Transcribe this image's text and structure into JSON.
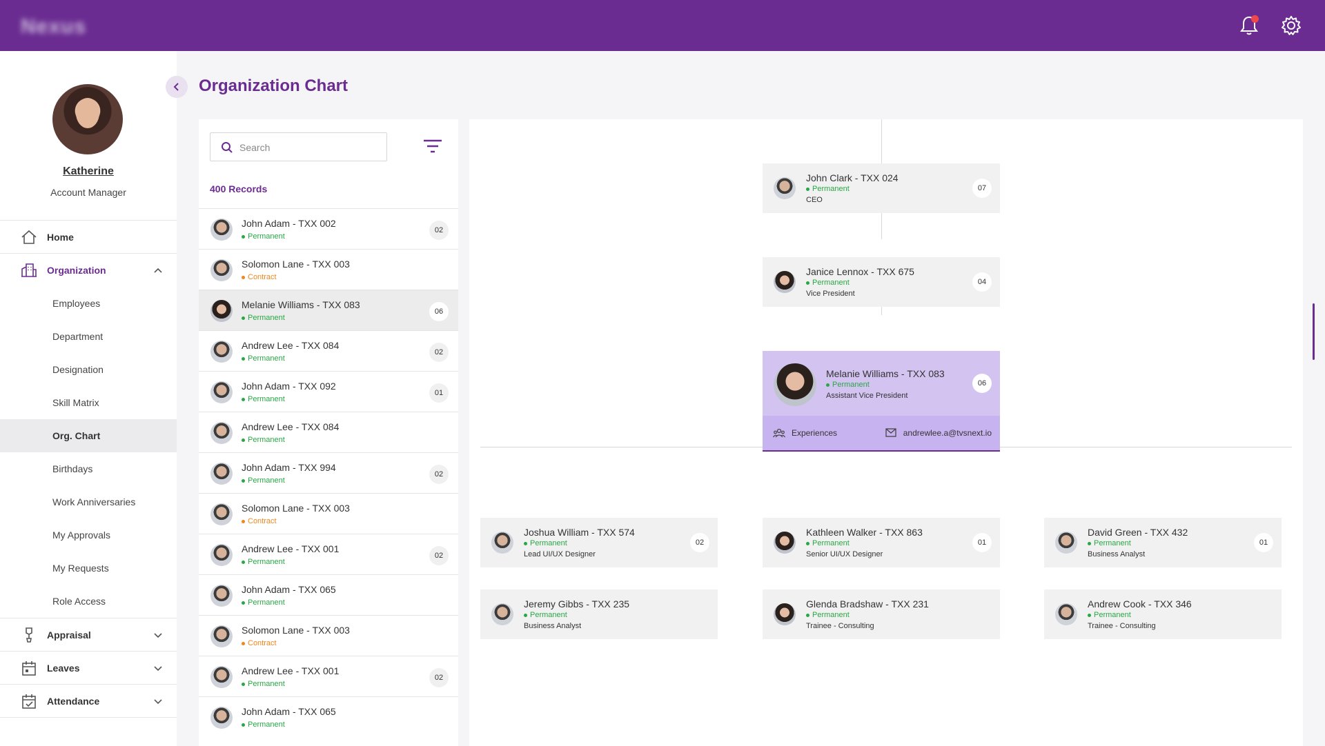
{
  "app": {
    "brand": "Nexus"
  },
  "user": {
    "name": "Katherine",
    "role": "Account Manager"
  },
  "nav": {
    "home": "Home",
    "organization": "Organization",
    "org_subitems": [
      "Employees",
      "Department",
      "Designation",
      "Skill Matrix",
      "Org. Chart",
      "Birthdays",
      "Work Anniversaries",
      "My Approvals",
      "My Requests",
      "Role Access"
    ],
    "selected_subitem": "Org. Chart",
    "appraisal": "Appraisal",
    "leaves": "Leaves",
    "attendance": "Attendance"
  },
  "page": {
    "title": "Organization Chart"
  },
  "list": {
    "search_placeholder": "Search",
    "records_label": "400 Records",
    "rows": [
      {
        "name": "John Adam - TXX 002",
        "status": "Permanent",
        "count": "02"
      },
      {
        "name": "Solomon Lane - TXX 003",
        "status": "Contract",
        "count": ""
      },
      {
        "name": "Melanie Williams - TXX 083",
        "status": "Permanent",
        "count": "06"
      },
      {
        "name": "Andrew Lee - TXX 084",
        "status": "Permanent",
        "count": "02"
      },
      {
        "name": "John Adam - TXX 092",
        "status": "Permanent",
        "count": "01"
      },
      {
        "name": "Andrew Lee - TXX 084",
        "status": "Permanent",
        "count": ""
      },
      {
        "name": "John Adam - TXX 994",
        "status": "Permanent",
        "count": "02"
      },
      {
        "name": "Solomon Lane - TXX 003",
        "status": "Contract",
        "count": ""
      },
      {
        "name": "Andrew Lee - TXX 001",
        "status": "Permanent",
        "count": "02"
      },
      {
        "name": "John Adam - TXX 065",
        "status": "Permanent",
        "count": ""
      },
      {
        "name": "Solomon Lane - TXX 003",
        "status": "Contract",
        "count": ""
      },
      {
        "name": "Andrew Lee - TXX 001",
        "status": "Permanent",
        "count": "02"
      },
      {
        "name": "John Adam - TXX 065",
        "status": "Permanent",
        "count": ""
      }
    ]
  },
  "chart": {
    "ceo": {
      "name": "John Clark  - TXX 024",
      "status": "Permanent",
      "designation": "CEO",
      "count": "07"
    },
    "vp": {
      "name": "Janice Lennox - TXX 675",
      "status": "Permanent",
      "designation": "Vice President",
      "count": "04"
    },
    "focus": {
      "name": "Melanie Williams - TXX 083",
      "status": "Permanent",
      "designation": "Assistant Vice President",
      "count": "06",
      "experiences_label": "Experiences",
      "email": "andrewlee.a@tvsnext.io"
    },
    "reports": [
      {
        "name": "Joshua William - TXX 574",
        "status": "Permanent",
        "designation": "Lead UI/UX Designer",
        "count": "02"
      },
      {
        "name": "Kathleen Walker - TXX 863",
        "status": "Permanent",
        "designation": "Senior UI/UX Designer",
        "count": "01"
      },
      {
        "name": "David Green - TXX 432",
        "status": "Permanent",
        "designation": "Business Analyst",
        "count": "01"
      },
      {
        "name": "Jeremy Gibbs - TXX 235",
        "status": "Permanent",
        "designation": "Business Analyst",
        "count": ""
      },
      {
        "name": "Glenda Bradshaw - TXX 231",
        "status": "Permanent",
        "designation": "Trainee - Consulting",
        "count": ""
      },
      {
        "name": "Andrew Cook - TXX 346",
        "status": "Permanent",
        "designation": "Trainee - Consulting",
        "count": ""
      }
    ]
  },
  "colors": {
    "brand": "#6a2c91",
    "permanent": "#27a844",
    "contract": "#f0861b",
    "focus_card": "#d3c3f1"
  }
}
